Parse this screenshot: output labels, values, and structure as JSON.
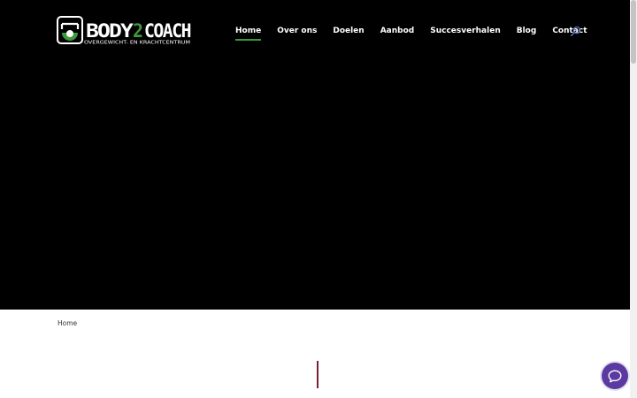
{
  "logo": {
    "brand": "BODY2COACH",
    "tagline": "OVERGEWICHT- EN KRACHTCENTRUM"
  },
  "nav": {
    "items": [
      {
        "label": "Home",
        "active": true
      },
      {
        "label": "Over ons"
      },
      {
        "label": "Doelen"
      },
      {
        "label": "Aanbod"
      },
      {
        "label": "Succesverhalen"
      },
      {
        "label": "Blog"
      },
      {
        "label": "Contact"
      }
    ],
    "search_icon": "search-icon"
  },
  "breadcrumb": {
    "current": "Home"
  },
  "chat": {
    "icon": "chat-bubble-icon"
  },
  "colors": {
    "hero_background": "#000000",
    "nav_active_underline": "#3d9a3a",
    "brand_green": "#3d9a3a",
    "chat_button": "#5a3aa0",
    "divider": "#7a1f35"
  }
}
